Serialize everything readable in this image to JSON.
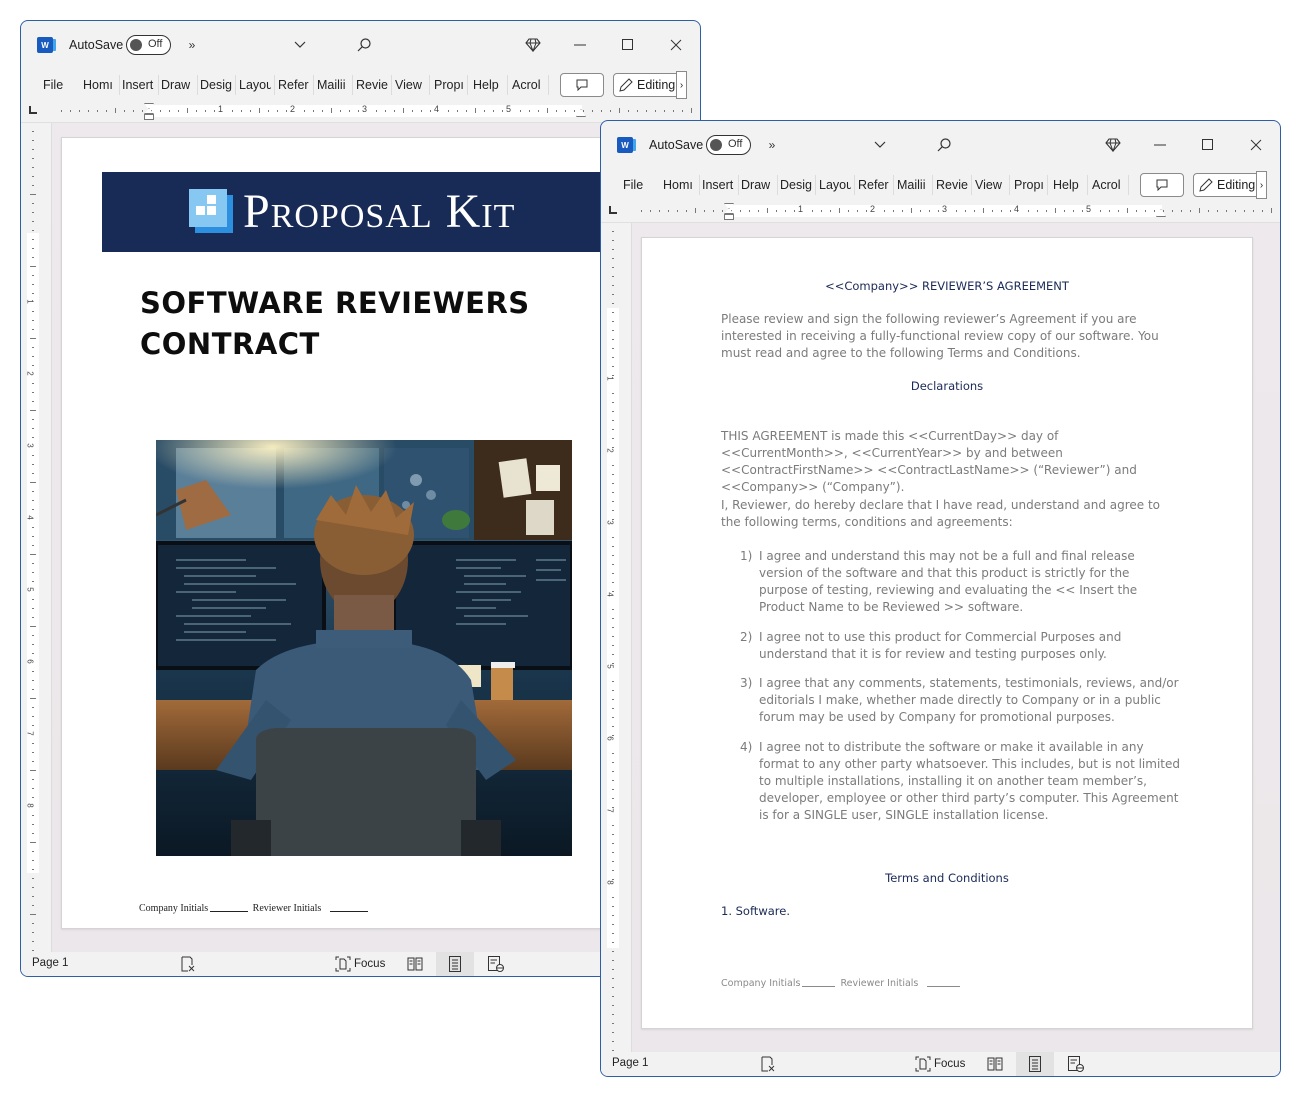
{
  "windows": [
    {
      "titlebar": {
        "autosave_label": "AutoSave",
        "autosave_state": "Off",
        "overflow": "»",
        "dropdown": "⌄"
      },
      "ribbon": {
        "tabs": [
          "File",
          "Homı",
          "Insert",
          "Draw",
          "Desig",
          "Layou",
          "Refer",
          "Mailii",
          "Revie",
          "View",
          "Propı",
          "Help",
          "Acrol"
        ],
        "editing_label": "Editing",
        "more": "›"
      },
      "ruler": {
        "numbers": [
          "1",
          "2",
          "3",
          "4",
          "5"
        ]
      },
      "vruler": {
        "numbers": [
          "1",
          "2",
          "3",
          "4",
          "5",
          "6",
          "7",
          "8"
        ]
      },
      "status": {
        "page": "Page 1",
        "focus_label": "Focus"
      }
    },
    {
      "titlebar": {
        "autosave_label": "AutoSave",
        "autosave_state": "Off",
        "overflow": "»",
        "dropdown": "⌄"
      },
      "ribbon": {
        "tabs": [
          "File",
          "Homı",
          "Insert",
          "Draw",
          "Desig",
          "Layou",
          "Refer",
          "Mailii",
          "Revie",
          "View",
          "Propı",
          "Help",
          "Acrol"
        ],
        "editing_label": "Editing",
        "more": "›"
      },
      "ruler": {
        "numbers": [
          "1",
          "2",
          "3",
          "4",
          "5"
        ]
      },
      "vruler": {
        "numbers": [
          "1",
          "2",
          "3",
          "4",
          "5",
          "6",
          "7",
          "8"
        ]
      },
      "status": {
        "page": "Page 1",
        "focus_label": "Focus"
      }
    }
  ],
  "cover": {
    "brand": "Proposal Kit",
    "title_line1": "SOFTWARE REVIEWERS",
    "title_line2": "CONTRACT",
    "image_alt": "Developer at desk with dual monitors showing code",
    "company_initials": "Company Initials",
    "reviewer_initials": "Reviewer Initials"
  },
  "agreement": {
    "heading": "<<Company>> REVIEWER’S AGREEMENT",
    "intro": "Please review and sign the following reviewer’s Agreement if you are interested in receiving a fully-functional review copy of our software. You must read and agree to the following Terms and Conditions.",
    "declarations_heading": "Declarations",
    "agreement_para": "THIS AGREEMENT is made this <<CurrentDay>> day of <<CurrentMonth>>, <<CurrentYear>> by and between <<ContractFirstName>> <<ContractLastName>> (“Reviewer”) and <<Company>> (“Company”).",
    "declare_para": "I, Reviewer, do hereby declare that I have read, understand and agree to the following terms, conditions and agreements:",
    "items": [
      {
        "num": "1)",
        "text": "I agree and understand this may not be a full and final release version of the software and that this product is strictly for the purpose of testing, reviewing and evaluating the << Insert the Product Name to be Reviewed >> software."
      },
      {
        "num": "2)",
        "text": "I agree not to use this product for Commercial Purposes and understand that it is for review and testing purposes only."
      },
      {
        "num": "3)",
        "text": "I agree that any comments, statements, testimonials, reviews, and/or editorials I make, whether made directly to Company or in a public forum may be used by Company for promotional purposes."
      },
      {
        "num": "4)",
        "text": "I agree not to distribute the software or make it available in any format to any other party whatsoever. This includes, but is not limited to multiple installations, installing it on another team member’s, developer, employee or other third party’s computer. This Agreement is for a SINGLE user, SINGLE installation license."
      }
    ],
    "terms_heading": "Terms and Conditions",
    "section1": "1. Software.",
    "company_initials": "Company Initials",
    "reviewer_initials": "Reviewer Initials"
  },
  "colors": {
    "banner": "#182b56",
    "heading_navy": "#1a2957",
    "window_border": "#2d5fa8",
    "word_blue": "#185abd"
  }
}
